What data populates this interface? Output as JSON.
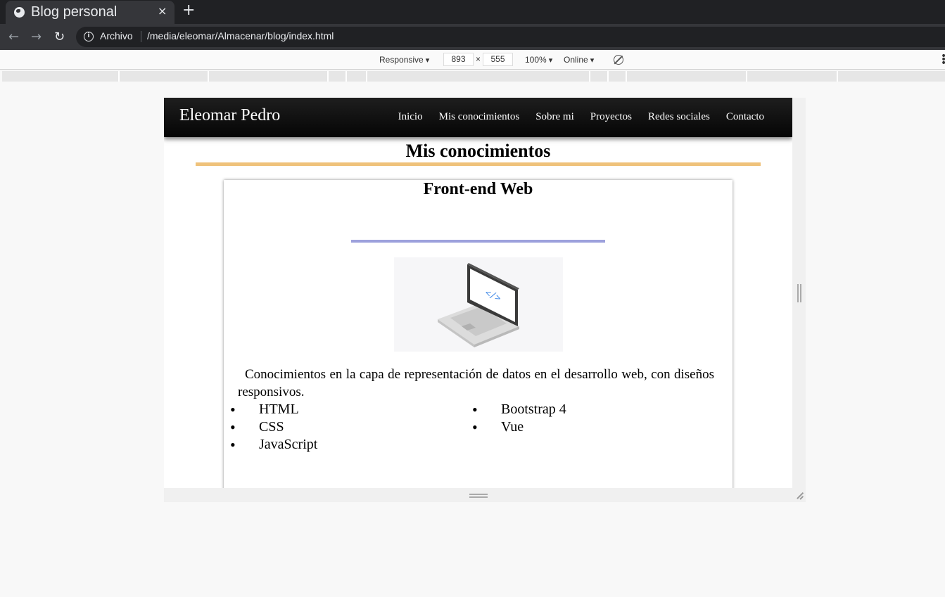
{
  "browser": {
    "tab_title": "Blog personal",
    "close_glyph": "×",
    "new_tab_glyph": "+",
    "url_scheme": "Archivo",
    "url": "/media/eleomar/Almacenar/blog/index.html"
  },
  "devtools": {
    "device": "Responsive",
    "width": "893",
    "height": "555",
    "times": "×",
    "zoom": "100%",
    "network": "Online"
  },
  "site": {
    "title": "Eleomar Pedro",
    "nav": [
      "Inicio",
      "Mis conocimientos",
      "Sobre mi",
      "Proyectos",
      "Redes sociales",
      "Contacto"
    ],
    "section_title": "Mis conocimientos",
    "card": {
      "title": "Front-end Web",
      "illustration": "laptop-code-icon",
      "description": "Conocimientos en la capa de representación de datos en el desarrollo web, con diseños responsivos.",
      "skills_left": [
        "HTML",
        "CSS",
        "JavaScript"
      ],
      "skills_right": [
        "Bootstrap 4",
        "Vue"
      ]
    }
  },
  "colors": {
    "section_rule": "#efc27b",
    "card_rule": "#9da1dc",
    "header_bg": "#111111"
  }
}
